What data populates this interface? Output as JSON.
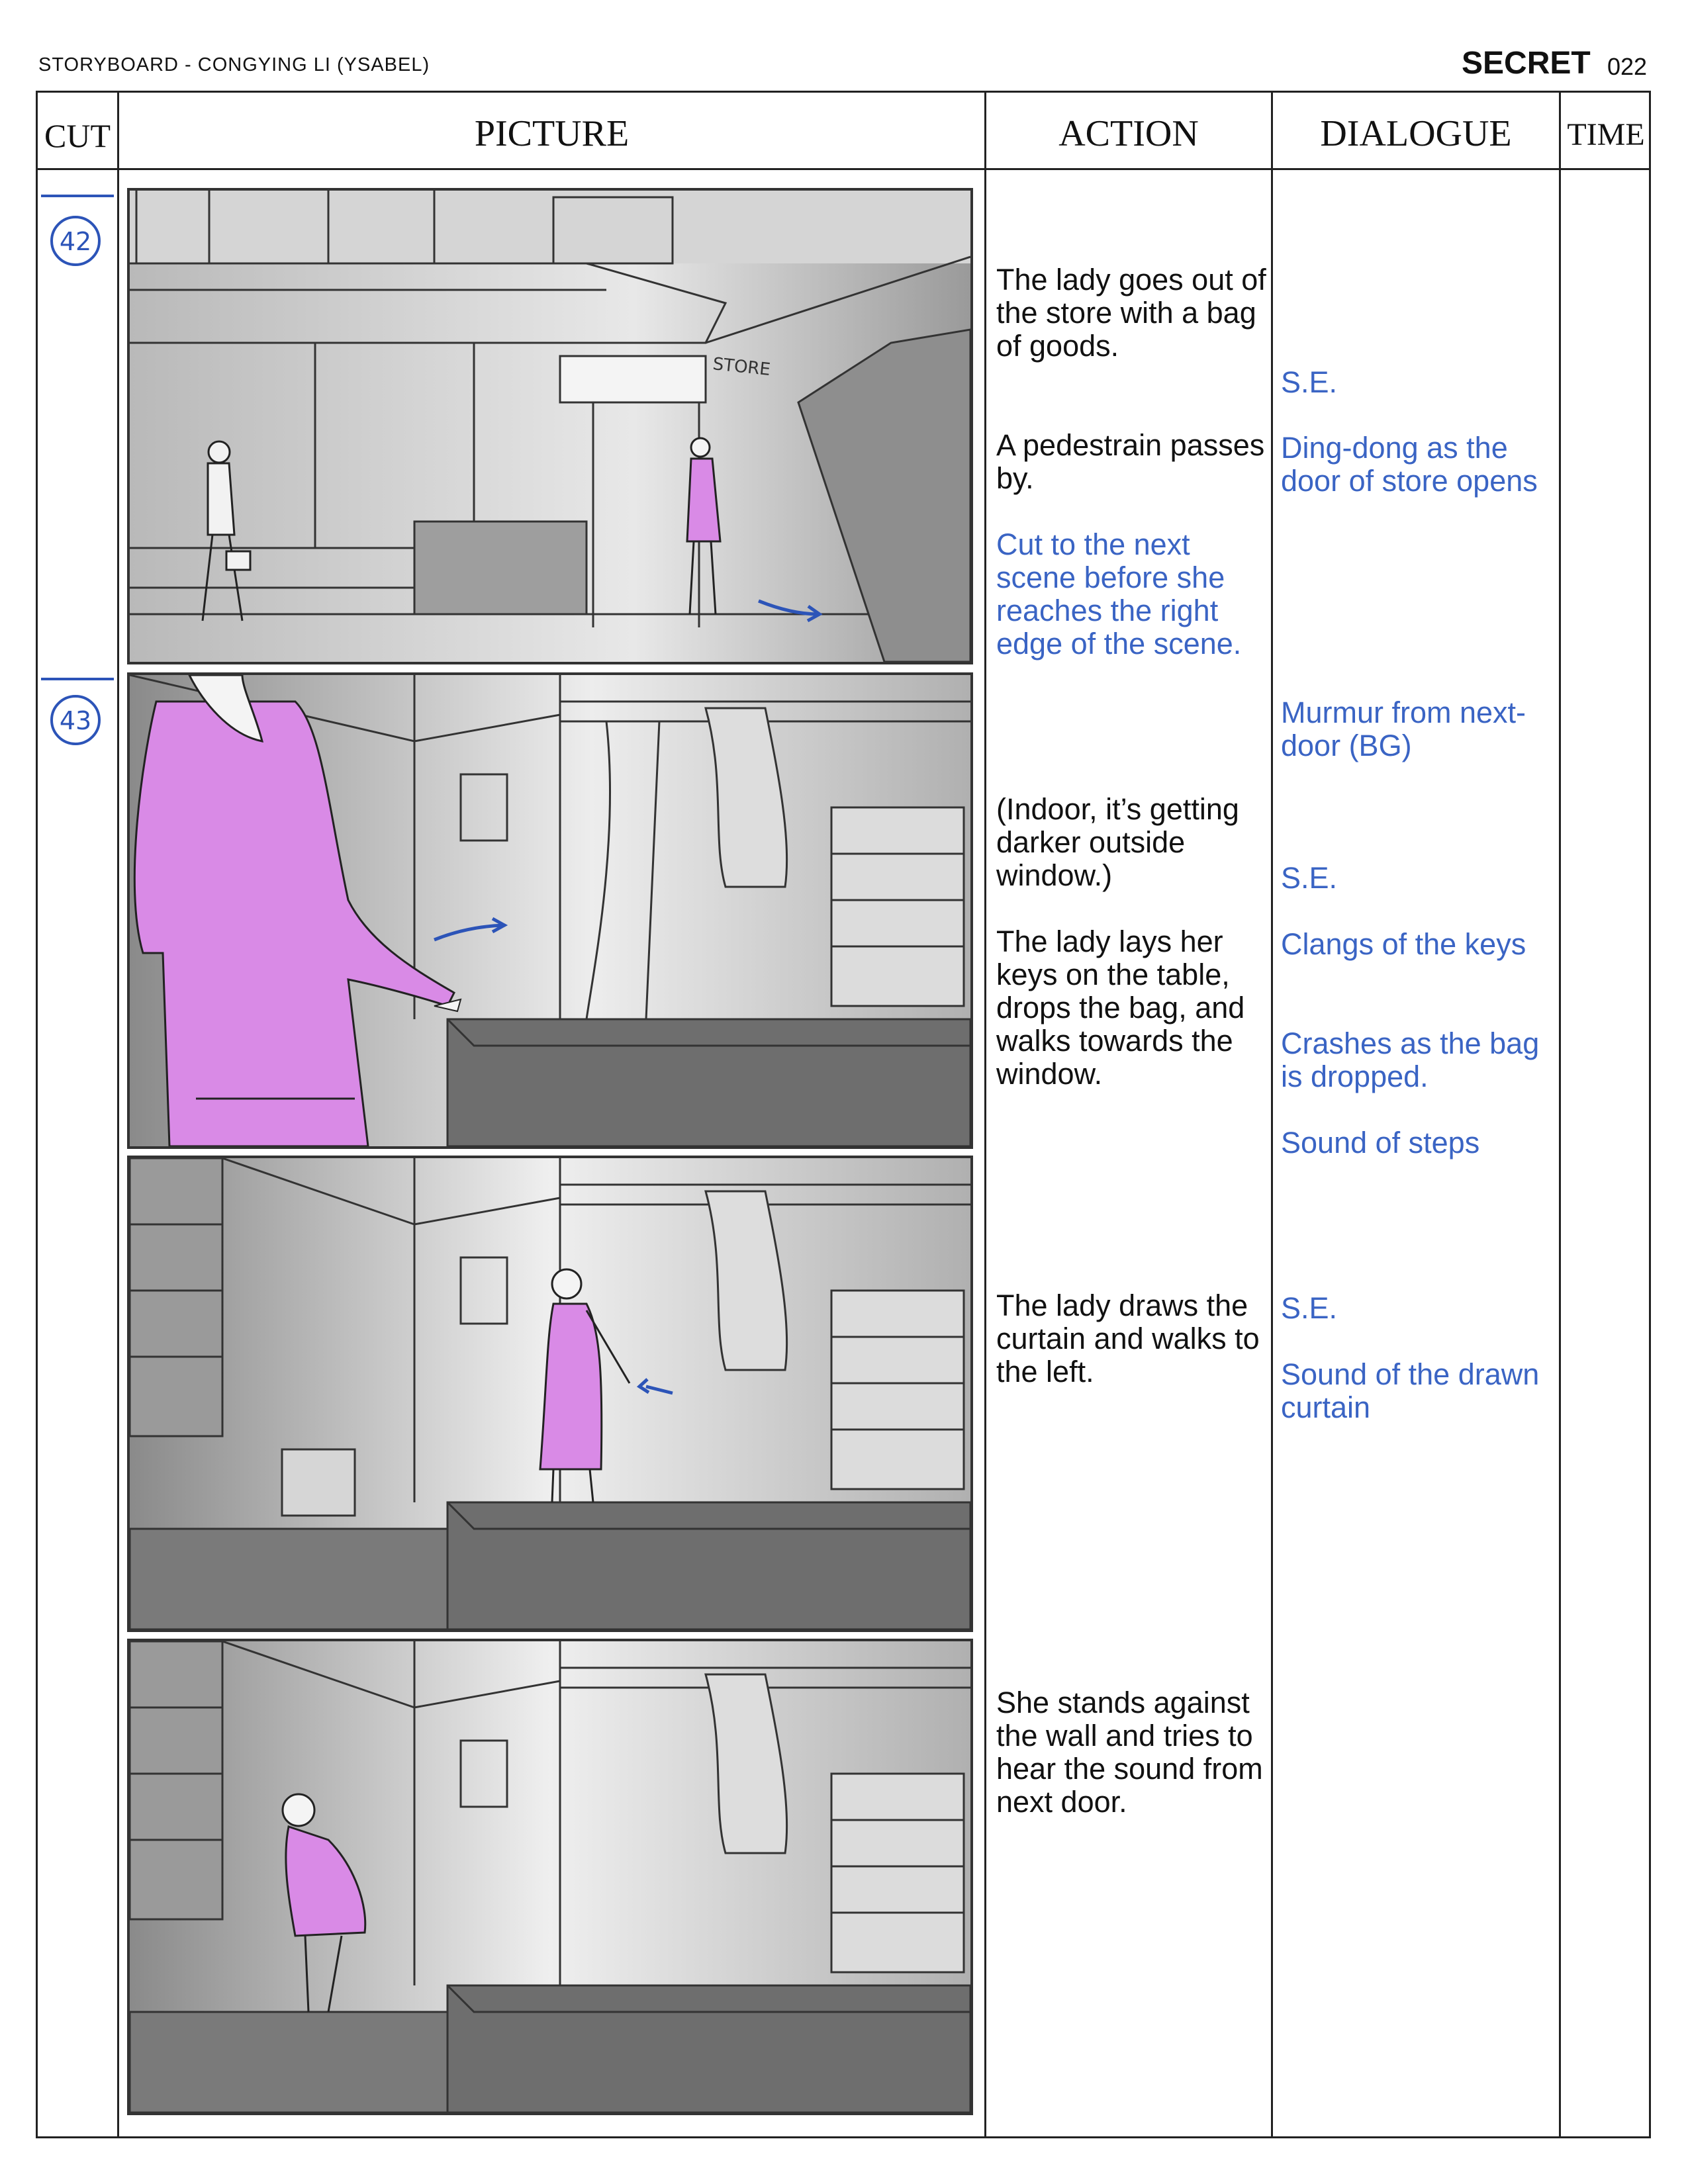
{
  "header": {
    "left_title": "STORYBOARD - CONGYING LI (YSABEL)",
    "title": "SECRET",
    "page": "022"
  },
  "columns": {
    "cut": "CUT",
    "picture": "PICTURE",
    "action": "ACTION",
    "dialogue": "DIALOGUE",
    "time": "TIME"
  },
  "cuts": [
    "42",
    "43"
  ],
  "panels": [
    "store-exterior",
    "room-keys-on-table",
    "room-drawing-curtain",
    "room-against-wall"
  ],
  "action": {
    "a1": "The lady goes out of the store with a bag of goods.",
    "a2": "A pedestrain passes by.",
    "a3": "Cut to the next scene before she reaches the right edge of the scene.",
    "a4": "(Indoor, it’s getting darker outside window.)",
    "a5": "The lady lays her keys on the table, drops the bag, and walks towards the window.",
    "a6": "The lady draws the curtain and walks to the left.",
    "a7": "She stands against the wall and tries to hear the sound from next door."
  },
  "dialogue": {
    "d1": "S.E.",
    "d2": "Ding-dong as the door of store opens",
    "d3": "Murmur from next-door (BG)",
    "d4": "S.E.",
    "d5": "Clangs of the keys",
    "d6": "Crashes as the bag is dropped.",
    "d7": "Sound of steps",
    "d8": "S.E.",
    "d9": "Sound of the drawn curtain"
  },
  "signage": {
    "store": "STORE"
  },
  "colors": {
    "dialogue_blue": "#3a64c4",
    "dress_magenta": "#d98ae6",
    "ink": "#222222"
  }
}
